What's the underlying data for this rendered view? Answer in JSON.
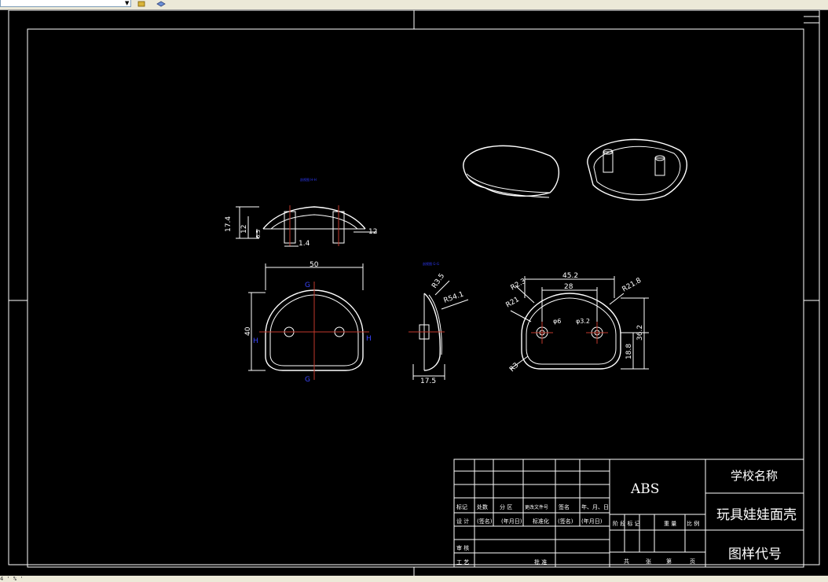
{
  "window": {
    "status_text": "4 ' % '"
  },
  "drawing": {
    "section_view_label": "剖视图 H-H",
    "section_view_label_2": "剖视图 G-G",
    "dims_section": [
      "17.4",
      "12",
      "6.5",
      "1.4",
      "12"
    ],
    "dims_front": [
      "50",
      "40"
    ],
    "markers_front": [
      "G",
      "G",
      "H",
      "H"
    ],
    "dims_side": [
      "R3.5",
      "R54.1",
      "17.5"
    ],
    "dims_bottom": [
      "45.2",
      "28",
      "R2.3",
      "R21.8",
      "R21",
      "φ6",
      "φ3.2",
      "R3",
      "18.8",
      "36.2"
    ]
  },
  "title_block": {
    "material": "ABS",
    "school": "学校名称",
    "part_name": "玩具娃娃面壳",
    "drawing_number": "图样代号",
    "row_header": [
      "标记",
      "处数",
      "分 区",
      "更改文件号",
      "签名",
      "年、月、日"
    ],
    "row_design": [
      "设 计",
      "(签名)",
      "(年月日)",
      "标准化",
      "(签名)",
      "(年月日)"
    ],
    "stage_labels": [
      "阶 段 标 记",
      "重 量",
      "比 例"
    ],
    "review": "审 核",
    "process": "工 艺",
    "approve": "批 准",
    "sheet_labels": [
      "共",
      "张",
      "第",
      "页"
    ]
  }
}
